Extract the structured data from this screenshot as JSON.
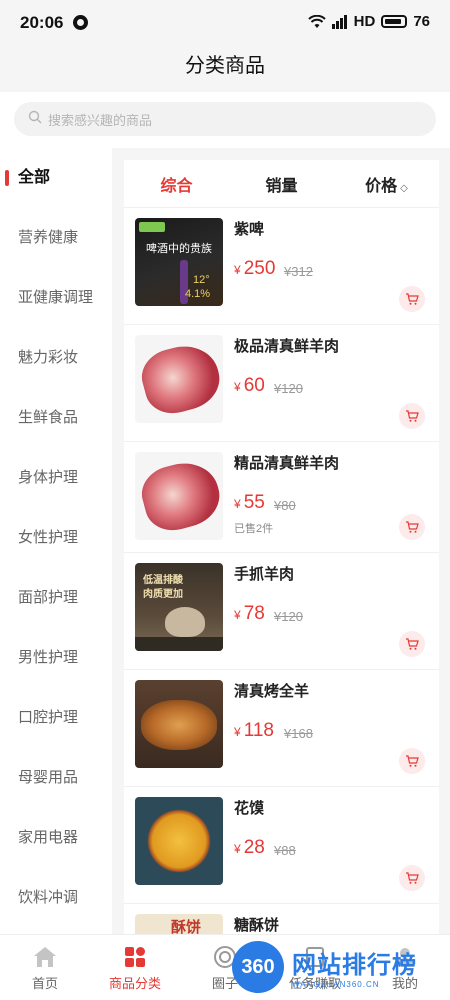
{
  "status_bar": {
    "time": "20:06",
    "network": "HD",
    "battery": "76"
  },
  "header": {
    "title": "分类商品"
  },
  "search": {
    "placeholder": "搜索感兴趣的商品"
  },
  "sidebar": {
    "items": [
      {
        "label": "全部",
        "active": true
      },
      {
        "label": "营养健康"
      },
      {
        "label": "亚健康调理"
      },
      {
        "label": "魅力彩妆"
      },
      {
        "label": "生鲜食品"
      },
      {
        "label": "身体护理"
      },
      {
        "label": "女性护理"
      },
      {
        "label": "面部护理"
      },
      {
        "label": "男性护理"
      },
      {
        "label": "口腔护理"
      },
      {
        "label": "母婴用品"
      },
      {
        "label": "家用电器"
      },
      {
        "label": "饮料冲调"
      }
    ]
  },
  "sort_tabs": [
    {
      "label": "综合",
      "active": true
    },
    {
      "label": "销量"
    },
    {
      "label": "价格"
    }
  ],
  "currency": "¥",
  "products": [
    {
      "name": "紫啤",
      "price": "250",
      "old_price": "¥312",
      "sold": "",
      "image_text_1": "啤酒中的贵族",
      "image_text_2": "12°",
      "image_text_3": "4.1%"
    },
    {
      "name": "极品清真鲜羊肉",
      "price": "60",
      "old_price": "¥120",
      "sold": ""
    },
    {
      "name": "精品清真鲜羊肉",
      "price": "55",
      "old_price": "¥80",
      "sold": "已售2件"
    },
    {
      "name": "手抓羊肉",
      "price": "78",
      "old_price": "¥120",
      "sold": "",
      "image_text_1": "低温排酸",
      "image_text_2": "肉质更加"
    },
    {
      "name": "清真烤全羊",
      "price": "118",
      "old_price": "¥168",
      "sold": ""
    },
    {
      "name": "花馍",
      "price": "28",
      "old_price": "¥88",
      "sold": ""
    },
    {
      "name": "糖酥饼",
      "price": "",
      "old_price": "",
      "sold": "",
      "image_text_1": "酥饼"
    }
  ],
  "tabbar": [
    {
      "label": "首页",
      "icon": "home-icon"
    },
    {
      "label": "商品分类",
      "icon": "category-icon",
      "active": true
    },
    {
      "label": "圈子",
      "icon": "circle-icon"
    },
    {
      "label": "任务赚取",
      "icon": "task-icon"
    },
    {
      "label": "我的",
      "icon": "profile-icon"
    }
  ],
  "watermark": {
    "badge": "360",
    "title": "网站排行榜",
    "subtitle": "WANGZHAN360.CN"
  },
  "colors": {
    "accent": "#e53935",
    "background": "#f5f5f5",
    "watermark": "#2a7be4"
  }
}
